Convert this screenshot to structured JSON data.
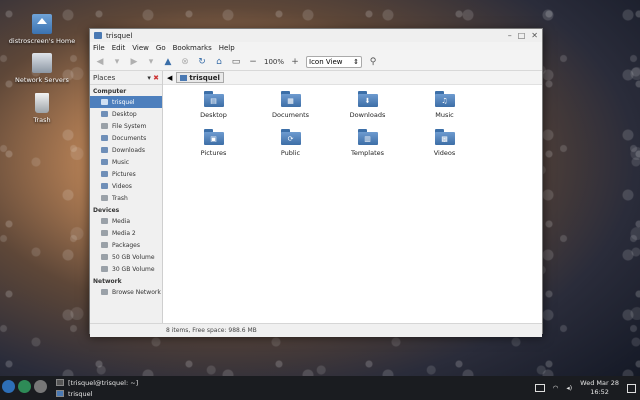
{
  "desktop": {
    "icons": [
      {
        "label": "distroscreen's Home"
      },
      {
        "label": "Network Servers"
      },
      {
        "label": "Trash"
      }
    ]
  },
  "window": {
    "title": "trisquel",
    "menu": [
      "File",
      "Edit",
      "View",
      "Go",
      "Bookmarks",
      "Help"
    ],
    "toolbar": {
      "zoom": "100%",
      "view_mode": "Icon View"
    },
    "sidebar": {
      "header": "Places",
      "sections": [
        {
          "title": "Computer",
          "items": [
            "trisquel",
            "Desktop",
            "File System",
            "Documents",
            "Downloads",
            "Music",
            "Pictures",
            "Videos",
            "Trash"
          ]
        },
        {
          "title": "Devices",
          "items": [
            "Media",
            "Media 2",
            "Packages",
            "50 GB Volume",
            "30 GB Volume"
          ]
        },
        {
          "title": "Network",
          "items": [
            "Browse Network"
          ]
        }
      ]
    },
    "path": "trisquel",
    "files": [
      {
        "name": "Desktop",
        "glyph": "▤"
      },
      {
        "name": "Documents",
        "glyph": "▦"
      },
      {
        "name": "Downloads",
        "glyph": "⬇"
      },
      {
        "name": "Music",
        "glyph": "♫"
      },
      {
        "name": "Pictures",
        "glyph": "▣"
      },
      {
        "name": "Public",
        "glyph": "⟳"
      },
      {
        "name": "Templates",
        "glyph": "▥"
      },
      {
        "name": "Videos",
        "glyph": "▩"
      }
    ],
    "status": "8 items, Free space: 988.6 MB"
  },
  "taskbar": {
    "tasks": [
      "[trisquel@trisquel: ~]",
      "trisquel"
    ],
    "clock": {
      "date": "Wed Mar 28",
      "time": "16:52"
    }
  }
}
